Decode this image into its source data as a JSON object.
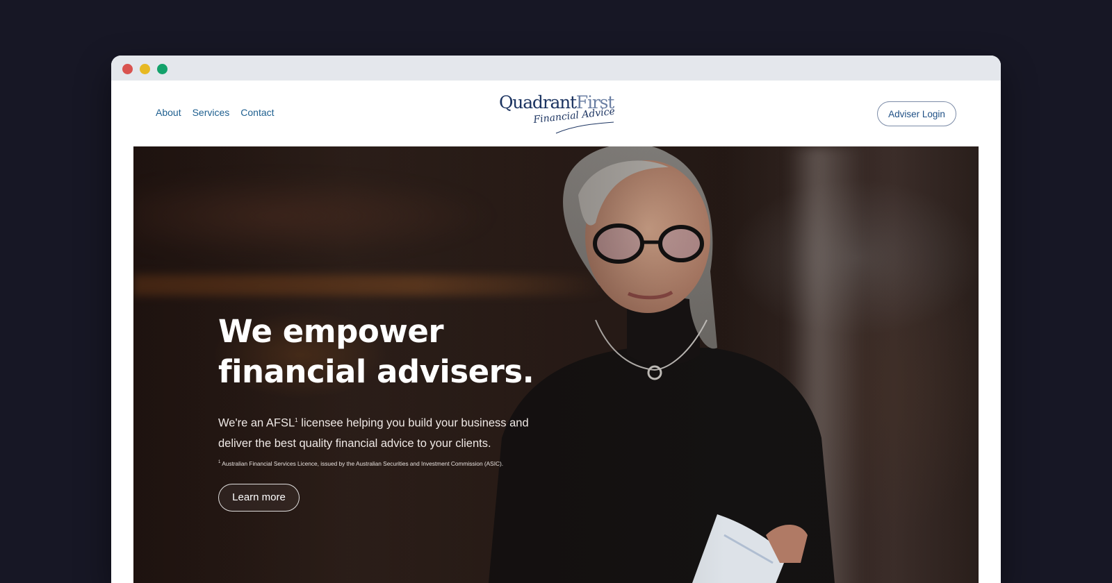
{
  "window": {
    "controls": [
      "close",
      "minimize",
      "maximize"
    ]
  },
  "nav": {
    "items": [
      {
        "label": "About"
      },
      {
        "label": "Services"
      },
      {
        "label": "Contact"
      }
    ]
  },
  "logo": {
    "line1_part1": "Quadrant",
    "line1_part2": "First",
    "line2": "Financial Advice"
  },
  "header": {
    "login_label": "Adviser Login"
  },
  "hero": {
    "title_line1": "We empower",
    "title_line2": "financial advisers.",
    "sub_part1": "We're an AFSL",
    "sub_sup": "1",
    "sub_part2": " licensee helping you build your business and deliver the best quality financial advice to your clients.",
    "footnote_sup": "1",
    "footnote_text": " Australian Financial Services Licence, issued by the Australian Securities and Investment Commission (ASIC).",
    "cta_label": "Learn more"
  },
  "colors": {
    "page_background": "#171725",
    "nav_link": "#1e5f8f",
    "logo_dark": "#1c3461",
    "logo_light": "#6b7fa3",
    "button_border": "#7b8ba7"
  }
}
